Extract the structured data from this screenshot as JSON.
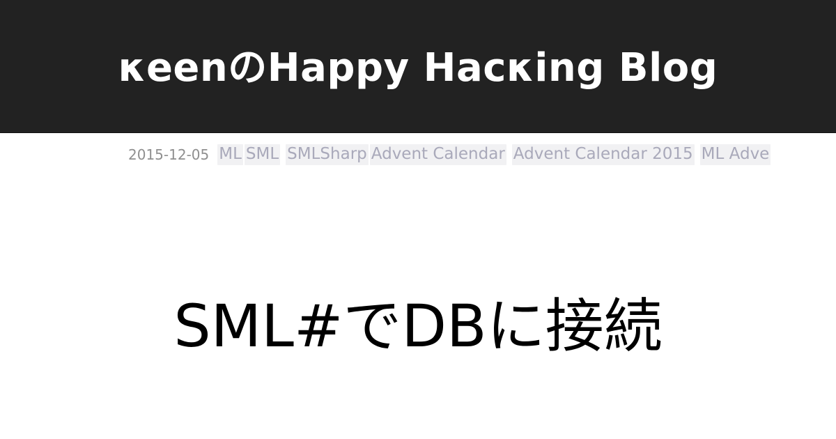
{
  "header": {
    "blog_title": "κeenのHappy Hacκing Blog"
  },
  "post": {
    "date": "2015-12-05",
    "tags": [
      "ML",
      "SML",
      "SMLSharp",
      "Advent Calendar",
      "Advent Calendar 2015",
      "ML Adve"
    ],
    "title": "SML#でDBに接続"
  },
  "colors": {
    "header_background": "#222222",
    "header_text": "#ffffff",
    "date_text": "#8f8f8f",
    "tag_text": "#a9a9ba",
    "tag_background": "#f1f1f3",
    "title_text": "#000000"
  }
}
